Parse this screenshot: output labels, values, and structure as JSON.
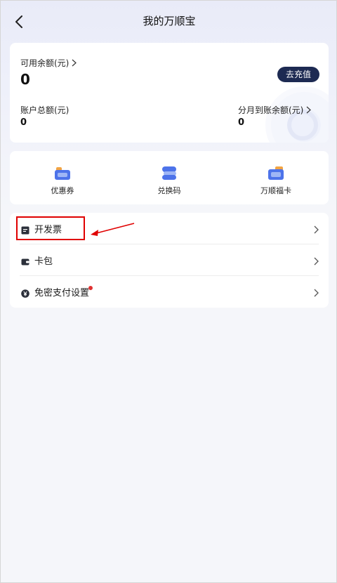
{
  "header": {
    "title": "我的万顺宝"
  },
  "balance": {
    "available_label": "可用余额(元)",
    "available_value": "0",
    "recharge_label": "去充值",
    "total_label": "账户总额(元)",
    "total_value": "0",
    "installment_label": "分月到账余额(元)",
    "installment_value": "0"
  },
  "quick_actions": [
    {
      "label": "优惠券",
      "icon": "coupon-icon"
    },
    {
      "label": "兑换码",
      "icon": "redeem-code-icon"
    },
    {
      "label": "万顺福卡",
      "icon": "gift-card-icon"
    }
  ],
  "menu": [
    {
      "label": "开发票",
      "icon": "invoice-icon"
    },
    {
      "label": "卡包",
      "icon": "wallet-icon"
    },
    {
      "label": "免密支付设置",
      "icon": "yen-icon",
      "badge": "red-dot"
    }
  ],
  "colors": {
    "accent": "#1d2a52",
    "annotation": "#e00000",
    "badge": "#e03131"
  }
}
